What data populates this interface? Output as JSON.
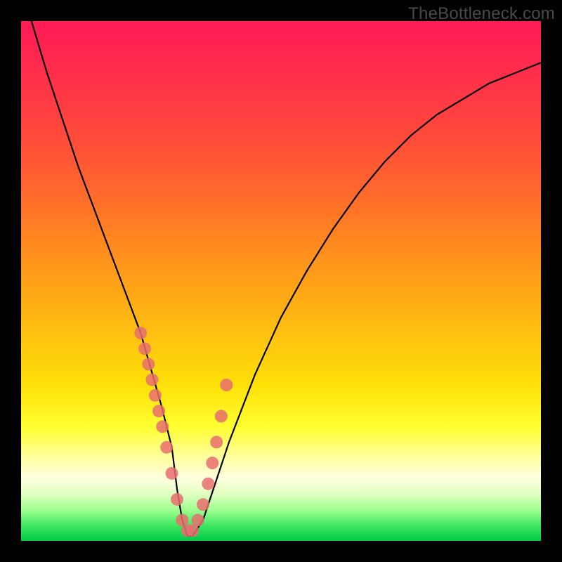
{
  "watermark": "TheBottleneck.com",
  "chart_data": {
    "type": "line",
    "title": "",
    "xlabel": "",
    "ylabel": "",
    "xlim": [
      0,
      100
    ],
    "ylim": [
      0,
      100
    ],
    "series": [
      {
        "name": "bottleneck-curve",
        "x": [
          2,
          5,
          8,
          11,
          14,
          17,
          20,
          23,
          25,
          27,
          29,
          30,
          31,
          32,
          33,
          35,
          37,
          40,
          45,
          50,
          55,
          60,
          65,
          70,
          75,
          80,
          85,
          90,
          95,
          100
        ],
        "y": [
          100,
          90,
          81,
          72,
          64,
          56,
          48,
          40,
          33,
          26,
          18,
          10,
          4,
          1,
          1,
          4,
          10,
          19,
          32,
          43,
          52,
          60,
          67,
          73,
          78,
          82,
          85,
          88,
          90,
          92
        ]
      }
    ],
    "markers": {
      "name": "sample-points",
      "x": [
        23.0,
        23.8,
        24.5,
        25.2,
        25.8,
        26.5,
        27.2,
        28.0,
        29.0,
        30.0,
        31.0,
        32.0,
        33.0,
        34.0,
        35.0,
        36.0,
        36.8,
        37.6,
        38.5,
        39.5
      ],
      "y": [
        40,
        37,
        34,
        31,
        28,
        25,
        22,
        18,
        13,
        8,
        4,
        2,
        2,
        4,
        7,
        11,
        15,
        19,
        24,
        30
      ],
      "color": "#e76f6f",
      "size": 9
    },
    "gradient_stops": [
      {
        "pos": 0.0,
        "color": "#ff1a55"
      },
      {
        "pos": 0.5,
        "color": "#ffa018"
      },
      {
        "pos": 0.8,
        "color": "#ffff30"
      },
      {
        "pos": 1.0,
        "color": "#00c84a"
      }
    ]
  }
}
